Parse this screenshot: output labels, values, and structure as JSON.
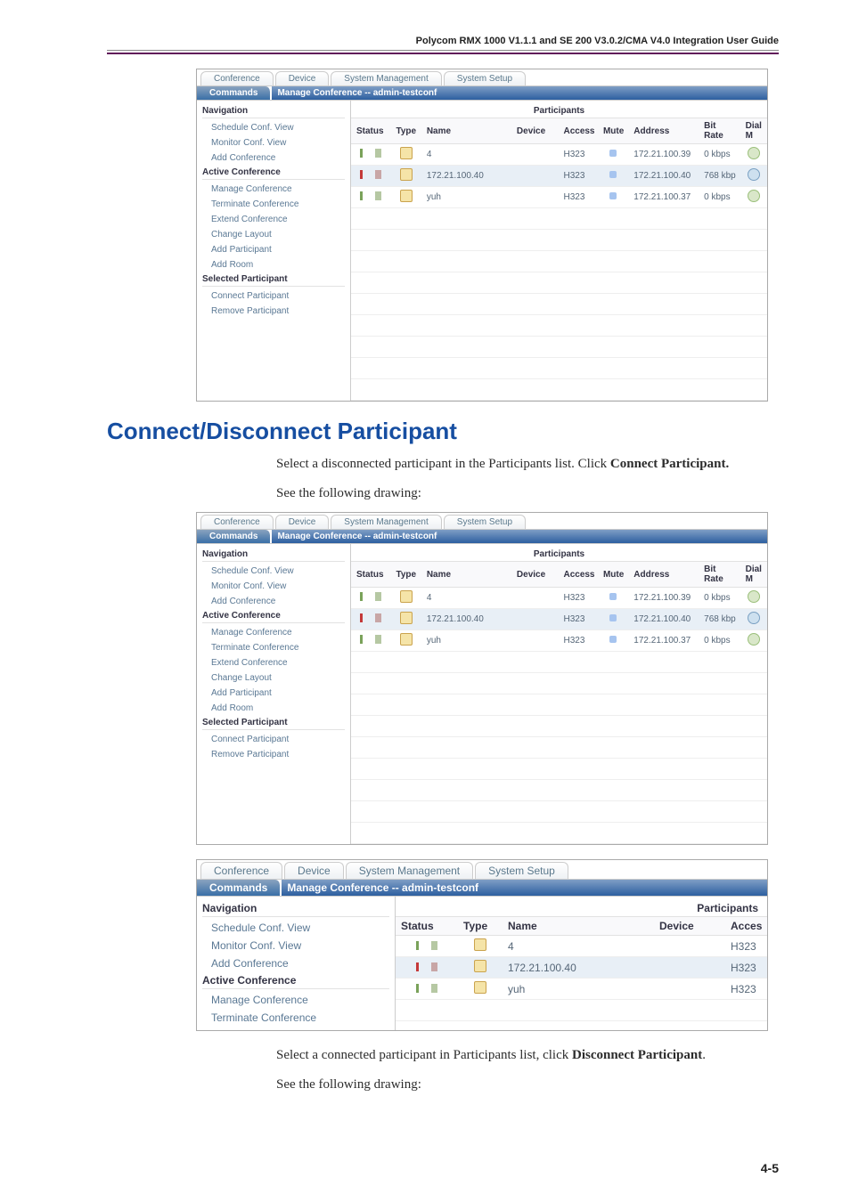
{
  "doc_header": "Polycom RMX 1000 V1.1.1 and SE 200 V3.0.2/CMA V4.0 Integration User Guide",
  "page_num": "4-5",
  "tabs": [
    "Conference",
    "Device",
    "System Management",
    "System Setup"
  ],
  "commands_label": "Commands",
  "title_bar": "Manage Conference -- admin-testconf",
  "sidebar": {
    "navigation": "Navigation",
    "nav_items": [
      "Schedule Conf. View",
      "Monitor Conf. View",
      "Add Conference"
    ],
    "active_conf": "Active Conference",
    "active_items": [
      "Manage Conference",
      "Terminate Conference",
      "Extend Conference",
      "Change Layout",
      "Add Participant",
      "Add Room"
    ],
    "selected": "Selected Participant",
    "selected_items": [
      "Connect Participant",
      "Remove Participant"
    ]
  },
  "participants_label": "Participants",
  "columns": {
    "status": "Status",
    "type": "Type",
    "name": "Name",
    "device": "Device",
    "access": "Access",
    "mute": "Mute",
    "address": "Address",
    "bitrate": "Bit Rate",
    "dial": "Dial M"
  },
  "columns_zoom": {
    "status": "Status",
    "type": "Type",
    "name": "Name",
    "device": "Device",
    "access": "Acces"
  },
  "rows": [
    {
      "name": "4",
      "access": "H323",
      "address": "172.21.100.39",
      "bitrate": "0 kbps",
      "hlt": false,
      "disc": false
    },
    {
      "name": "172.21.100.40",
      "access": "H323",
      "address": "172.21.100.40",
      "bitrate": "768 kbp",
      "hlt": true,
      "disc": true
    },
    {
      "name": "yuh",
      "access": "H323",
      "address": "172.21.100.37",
      "bitrate": "0 kbps",
      "hlt": false,
      "disc": false
    }
  ],
  "rows_zoom": [
    {
      "name": "4",
      "access": "H323",
      "disc": false,
      "hlt": false
    },
    {
      "name": "172.21.100.40",
      "access": "H323",
      "disc": true,
      "hlt": true
    },
    {
      "name": "yuh",
      "access": "H323",
      "disc": false,
      "hlt": false
    }
  ],
  "section_heading": "Connect/Disconnect Participant",
  "body": {
    "p1a": "Select a disconnected participant in the Participants list. Click ",
    "p1b": "Connect Participant.",
    "p2": "See the following drawing:",
    "p3a": "Select a connected participant in Participants list, click ",
    "p3b": "Disconnect Participant",
    "p3c": ".",
    "p4": "See the following drawing:"
  }
}
